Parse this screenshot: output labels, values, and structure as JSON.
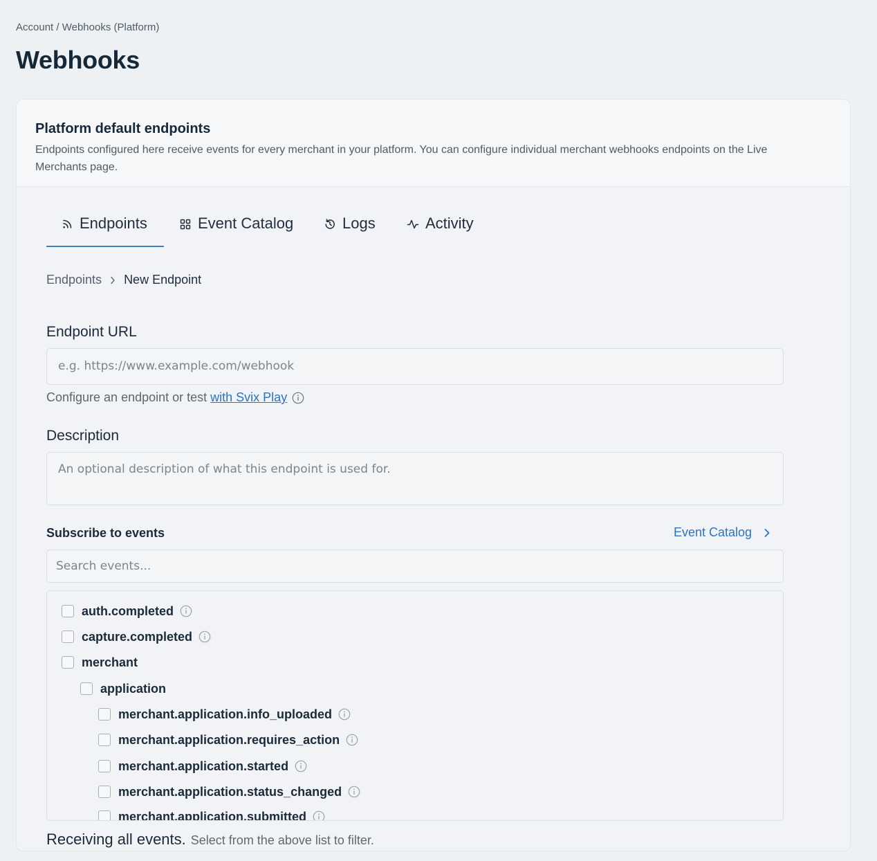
{
  "breadcrumb": {
    "account": "Account",
    "separator": "/",
    "current": "Webhooks (Platform)"
  },
  "page": {
    "title": "Webhooks"
  },
  "card": {
    "title": "Platform default endpoints",
    "description": "Endpoints configured here receive events for every merchant in your platform. You can configure individual merchant webhooks endpoints on the Live Merchants page."
  },
  "tabs": [
    {
      "label": "Endpoints",
      "icon": "rss-icon",
      "active": true
    },
    {
      "label": "Event Catalog",
      "icon": "grid-icon",
      "active": false
    },
    {
      "label": "Logs",
      "icon": "history-icon",
      "active": false
    },
    {
      "label": "Activity",
      "icon": "activity-icon",
      "active": false
    }
  ],
  "sub_breadcrumb": {
    "parent": "Endpoints",
    "current": "New Endpoint"
  },
  "form": {
    "url_label": "Endpoint URL",
    "url_placeholder": "e.g. https://www.example.com/webhook",
    "hint_text": "Configure an endpoint or test",
    "hint_link": "with Svix Play",
    "description_label": "Description",
    "description_placeholder": "An optional description of what this endpoint is used for."
  },
  "events": {
    "label": "Subscribe to events",
    "catalog_link": "Event Catalog",
    "search_placeholder": "Search events...",
    "items": [
      {
        "name": "auth.completed",
        "level": 0,
        "info": true,
        "checked": false
      },
      {
        "name": "capture.completed",
        "level": 0,
        "info": true,
        "checked": false
      },
      {
        "name": "merchant",
        "level": 0,
        "info": false,
        "checked": false
      },
      {
        "name": "application",
        "level": 1,
        "info": false,
        "checked": false
      },
      {
        "name": "merchant.application.info_uploaded",
        "level": 2,
        "info": true,
        "checked": false
      },
      {
        "name": "merchant.application.requires_action",
        "level": 2,
        "info": true,
        "checked": false
      },
      {
        "name": "merchant.application.started",
        "level": 2,
        "info": true,
        "checked": false
      },
      {
        "name": "merchant.application.status_changed",
        "level": 2,
        "info": true,
        "checked": false
      },
      {
        "name": "merchant.application.submitted",
        "level": 2,
        "info": true,
        "checked": false
      }
    ]
  },
  "footer": {
    "strong": "Receiving all events.",
    "weak": "Select from the above list to filter."
  },
  "colors": {
    "accent": "#3b82c4",
    "link": "#2d73bd",
    "background": "#eef1f3"
  }
}
